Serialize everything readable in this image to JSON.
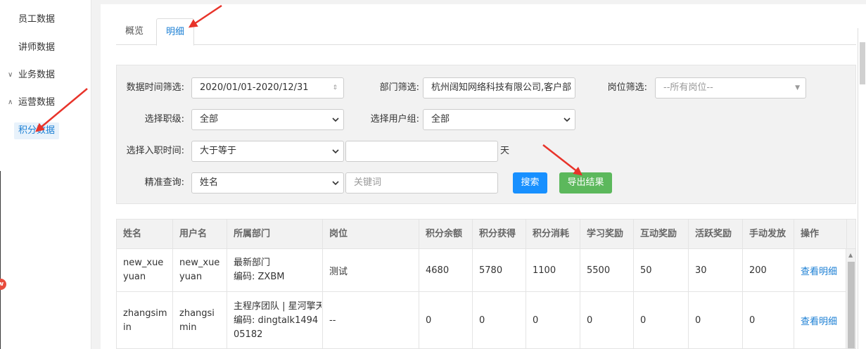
{
  "sidebar": {
    "items": [
      {
        "label": "员工数据",
        "caret": ""
      },
      {
        "label": "讲师数据",
        "caret": ""
      },
      {
        "label": "业务数据",
        "caret": "∨"
      },
      {
        "label": "运营数据",
        "caret": "∧"
      },
      {
        "label": "积分数据",
        "caret": ""
      }
    ],
    "badge": "w"
  },
  "tabs": [
    {
      "label": "概览"
    },
    {
      "label": "明细"
    }
  ],
  "filters": {
    "time_label": "数据时间筛选:",
    "time_value": "2020/01/01-2020/12/31",
    "dept_label": "部门筛选:",
    "dept_value": "杭州阔知网络科技有限公司,客户部",
    "post_label": "岗位筛选:",
    "post_placeholder": "--所有岗位--",
    "level_label": "选择职级:",
    "level_value": "全部",
    "group_label": "选择用户组:",
    "group_value": "全部",
    "hire_label": "选择入职时间:",
    "hire_op": "大于等于",
    "hire_days": "",
    "hire_unit": "天",
    "query_label": "精准查询:",
    "query_field": "姓名",
    "keyword_placeholder": "关键词",
    "search_button": "搜索",
    "export_button": "导出结果"
  },
  "table": {
    "headers": [
      "姓名",
      "用户名",
      "所属部门",
      "岗位",
      "积分余额",
      "积分获得",
      "积分消耗",
      "学习奖励",
      "互动奖励",
      "活跃奖励",
      "手动发放",
      "操作"
    ],
    "rows": [
      {
        "name": "new_xueyuan",
        "username": "new_xueyuan",
        "dept": "最新部门",
        "dept_code": "编码:  ZXBM",
        "post": "测试",
        "balance": "4680",
        "earned": "5780",
        "spent": "1100",
        "study": "5500",
        "interact": "50",
        "active": "30",
        "manual": "200",
        "action": "查看明细"
      },
      {
        "name": "zhangsimin",
        "username": "zhangsimin",
        "dept": "主程序团队 | 星河擎天",
        "dept_code": "编码:  dingtalk149405182",
        "post": "--",
        "balance": "0",
        "earned": "0",
        "spent": "0",
        "study": "0",
        "interact": "0",
        "active": "0",
        "manual": "0",
        "action": "查看明细"
      }
    ]
  },
  "colors": {
    "accent": "#1b7fd4",
    "search": "#1890ff",
    "export": "#5cb85c",
    "annotation": "#e8332a"
  }
}
